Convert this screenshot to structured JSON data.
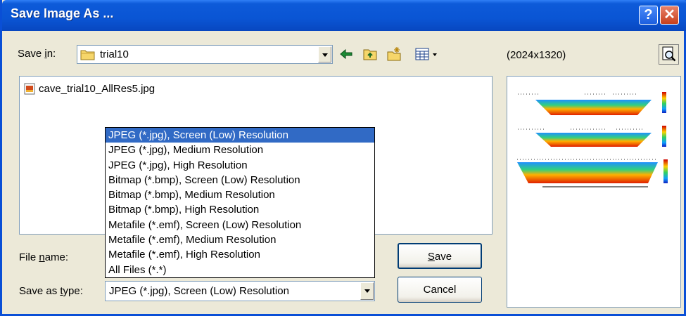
{
  "window": {
    "title": "Save Image As ..."
  },
  "save_in": {
    "label_pre": "Save ",
    "label_key": "i",
    "label_post": "n:",
    "value": "trial10"
  },
  "resolution": "(2024x1320)",
  "files": [
    {
      "name": "cave_trial10_AllRes5.jpg"
    }
  ],
  "file_name": {
    "label_pre": "File ",
    "label_key": "n",
    "label_post": "ame:",
    "value": ""
  },
  "save_as_type": {
    "label_pre": "Save as ",
    "label_key": "t",
    "label_post": "ype:",
    "value": "JPEG (*.jpg), Screen (Low) Resolution"
  },
  "dropdown_options": [
    "JPEG (*.jpg), Screen (Low) Resolution",
    "JPEG (*.jpg), Medium Resolution",
    "JPEG (*.jpg), High Resolution",
    "Bitmap (*.bmp), Screen (Low) Resolution",
    "Bitmap (*.bmp), Medium Resolution",
    "Bitmap (*.bmp), High Resolution",
    "Metafile (*.emf), Screen (Low) Resolution",
    "Metafile (*.emf), Medium Resolution",
    "Metafile (*.emf), High Resolution",
    "All Files (*.*)"
  ],
  "selected_option_index": 0,
  "buttons": {
    "save_key": "S",
    "save_rest": "ave",
    "cancel": "Cancel"
  },
  "colors": {
    "title_bar": "#0a55d4",
    "selection": "#316ac5",
    "dialog_bg": "#ece9d8"
  },
  "icons": [
    "help-icon",
    "close-icon",
    "folder-icon",
    "back-arrow-icon",
    "up-folder-icon",
    "new-folder-icon",
    "view-menu-icon",
    "preview-icon",
    "jpg-file-icon"
  ]
}
